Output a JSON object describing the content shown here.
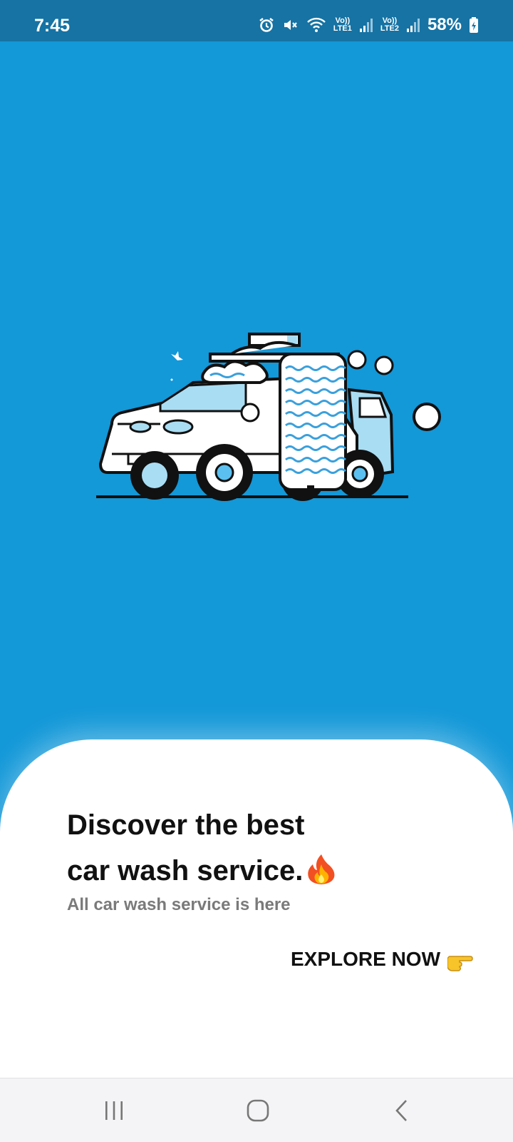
{
  "status_bar": {
    "time": "7:45",
    "network_1": {
      "volte": "Vo))",
      "label": "LTE1"
    },
    "network_2": {
      "volte": "Vo))",
      "label": "LTE2"
    },
    "battery": "58%",
    "icons": [
      "alarm-icon",
      "mute-icon",
      "wifi-icon",
      "signal-icon",
      "battery-charging-icon"
    ]
  },
  "hero": {
    "background_color": "#1398d8",
    "illustration": "car-wash-icon"
  },
  "sheet": {
    "headline_line1": "Discover the best",
    "headline_line2": "car wash service.",
    "headline_emoji": "fire-icon",
    "subtitle": "All car wash service is here",
    "cta_label": "EXPLORE NOW",
    "cta_icon": "pointing-hand-icon"
  },
  "nav_bar": {
    "buttons": [
      "recents-icon",
      "home-icon",
      "back-icon"
    ]
  }
}
